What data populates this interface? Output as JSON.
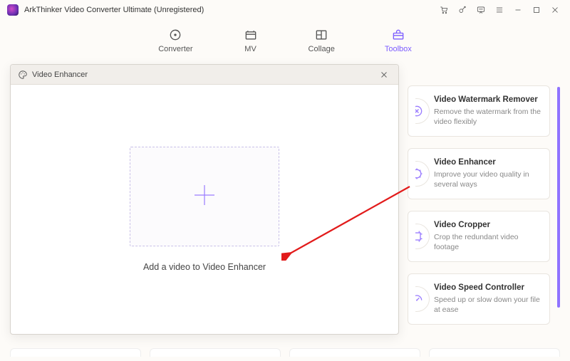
{
  "titlebar": {
    "title": "ArkThinker Video Converter Ultimate (Unregistered)"
  },
  "nav": {
    "converter": "Converter",
    "mv": "MV",
    "collage": "Collage",
    "toolbox": "Toolbox"
  },
  "dialog": {
    "title": "Video Enhancer",
    "caption": "Add a video to Video Enhancer"
  },
  "cards": {
    "watermark": {
      "title": "Video Watermark Remover",
      "desc": "Remove the watermark from the video flexibly"
    },
    "enhancer": {
      "title": "Video Enhancer",
      "desc": "Improve your video quality in several ways"
    },
    "cropper": {
      "title": "Video Cropper",
      "desc": "Crop the redundant video footage"
    },
    "speed": {
      "title": "Video Speed Controller",
      "desc": "Speed up or slow down your file at ease"
    }
  }
}
